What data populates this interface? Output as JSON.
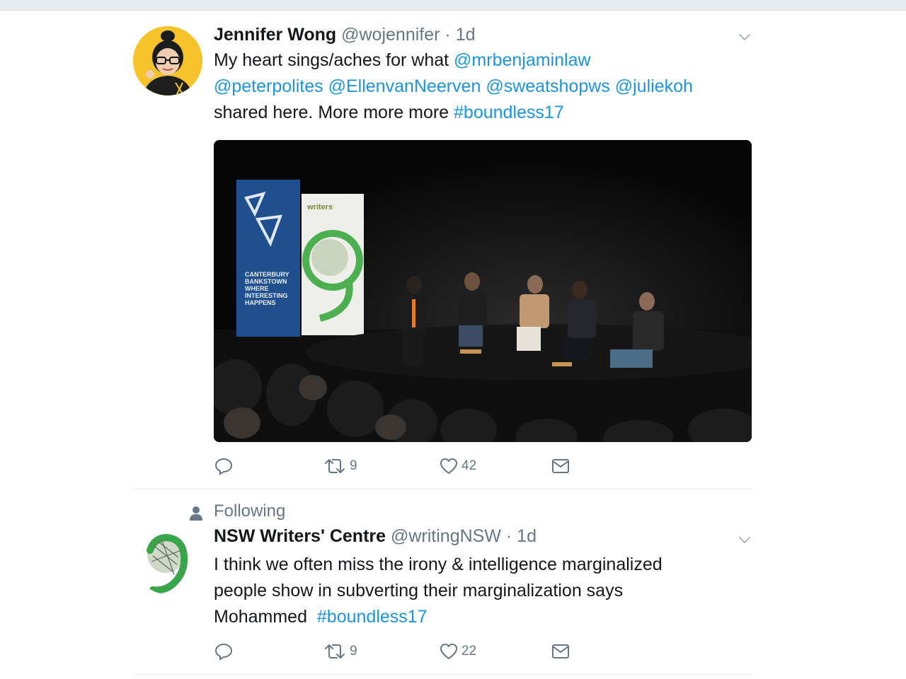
{
  "colors": {
    "link": "#1b95e0",
    "muted": "#657786",
    "text": "#14171a",
    "divider": "#e6ecf0"
  },
  "tweets": [
    {
      "author_name": "Jennifer Wong",
      "handle": "@wojennifer",
      "separator": "·",
      "time": "1d",
      "body": {
        "t1": "My heart sings/aches for what ",
        "m1": "@mrbenjaminlaw",
        "m2": "@peterpolites",
        "s1": " ",
        "m3": "@EllenvanNeerven",
        "s2": " ",
        "m4": "@sweatshopws",
        "s3": " ",
        "m5": "@juliekoh",
        "t2": "shared here. More more more ",
        "h1": "#boundless17"
      },
      "media": {
        "banner_left": [
          "CANTERBURY",
          "BANKSTOWN",
          "WHERE",
          "INTERESTING",
          "HAPPENS"
        ],
        "banner_right": "writers"
      },
      "actions": {
        "reply_icon": "reply-icon",
        "retweet_icon": "retweet-icon",
        "retweet_count": "9",
        "like_icon": "heart-icon",
        "like_count": "42",
        "dm_icon": "envelope-icon"
      }
    },
    {
      "social_context": "Following",
      "author_name": "NSW Writers' Centre",
      "handle": "@writingNSW",
      "separator": "·",
      "time": "1d",
      "body": {
        "t1": "I think we often miss the irony & intelligence marginalized",
        "t2": "people show in subverting their marginalization says",
        "t3": "Mohammed  ",
        "h1": "#boundless17"
      },
      "actions": {
        "reply_icon": "reply-icon",
        "retweet_icon": "retweet-icon",
        "retweet_count": "9",
        "like_icon": "heart-icon",
        "like_count": "22",
        "dm_icon": "envelope-icon"
      }
    }
  ]
}
